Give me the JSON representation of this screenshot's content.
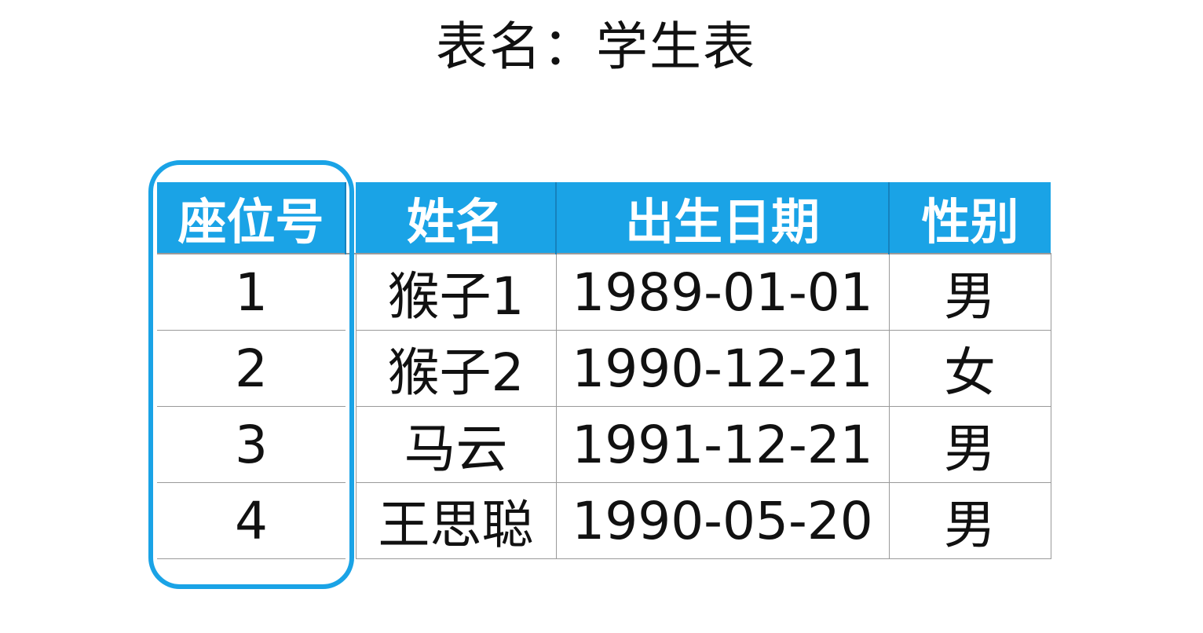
{
  "title": "表名：学生表",
  "table": {
    "columns": [
      "座位号",
      "姓名",
      "出生日期",
      "性别"
    ],
    "rows": [
      [
        "1",
        "猴子1",
        "1989-01-01",
        "男"
      ],
      [
        "2",
        "猴子2",
        "1990-12-21",
        "女"
      ],
      [
        "3",
        "马云",
        "1991-12-21",
        "男"
      ],
      [
        "4",
        "王思聪",
        "1990-05-20",
        "男"
      ]
    ]
  },
  "colors": {
    "header_background": "#1aa3e6",
    "header_text": "#ffffff",
    "highlight_outline": "#1aa3e6",
    "grid_lines": "#9a9a9a"
  }
}
